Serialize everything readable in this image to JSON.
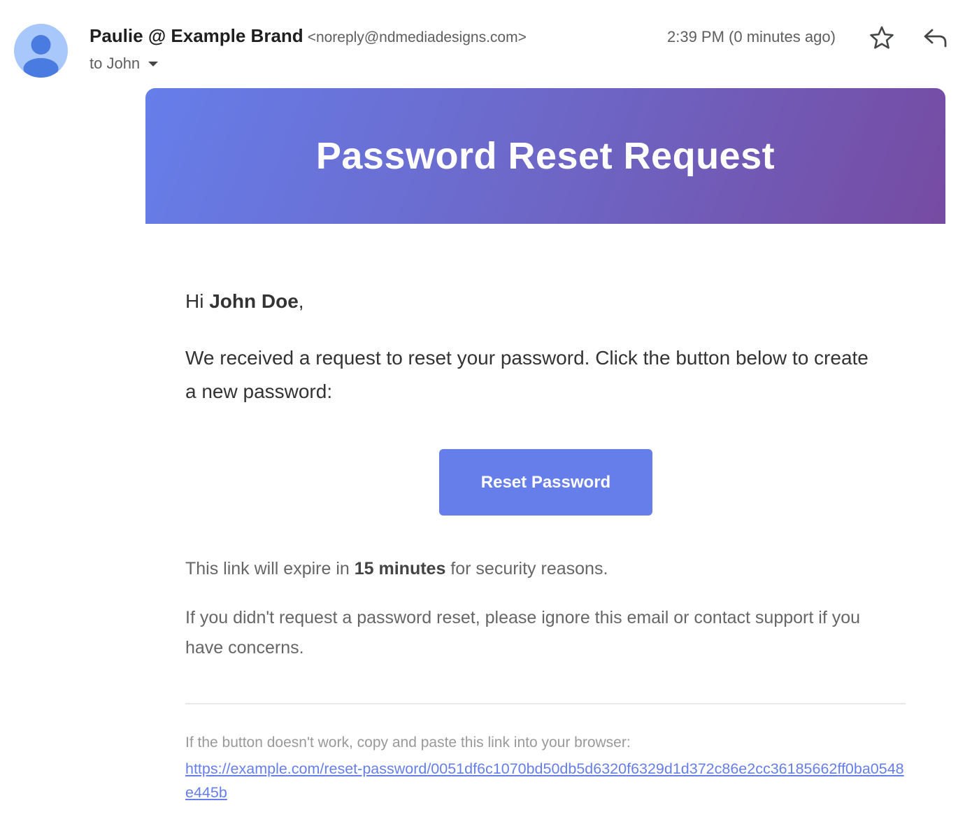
{
  "header": {
    "sender_name": "Paulie @ Example Brand",
    "sender_email": "<noreply@ndmediadesigns.com>",
    "recipient": "to John",
    "timestamp": "2:39 PM (0 minutes ago)",
    "avatar_icon": "default-avatar-icon",
    "star_icon": "star-outline-icon",
    "reply_icon": "reply-arrow-icon"
  },
  "email": {
    "banner_title": "Password Reset Request",
    "greeting_prefix": "Hi ",
    "greeting_name": "John Doe",
    "greeting_suffix": ",",
    "intro": "We received a request to reset your password. Click the button below to create a new password:",
    "button_label": "Reset Password",
    "expire_prefix": "This link will expire in ",
    "expire_time": "15 minutes",
    "expire_suffix": " for security reasons.",
    "ignore_text": "If you didn't request a password reset, please ignore this email or contact support if you have concerns.",
    "fallback_text": "If the button doesn't work, copy and paste this link into your browser:",
    "reset_link": "https://example.com/reset-password/0051df6c1070bd50db5d6320f6329d1d372c86e2cc36185662ff0ba0548e445b"
  },
  "colors": {
    "gradient_start": "#667eea",
    "gradient_end": "#764ba2",
    "button": "#667eea",
    "avatar_bg": "#a8c7fa",
    "avatar_fg": "#4285f4"
  }
}
